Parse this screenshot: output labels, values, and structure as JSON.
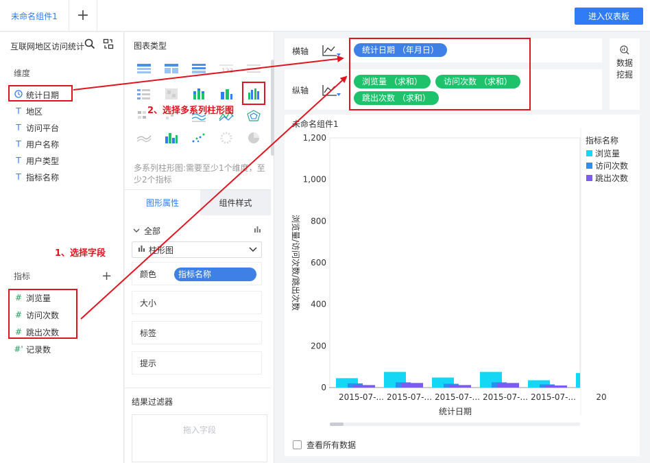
{
  "tabbar": {
    "active_tab": "未命名组件1",
    "add_symbol": "+",
    "dashboard_button": "进入仪表板"
  },
  "dataset": {
    "name": "互联网地区访问统计",
    "dimensions_title": "维度",
    "dimensions": [
      {
        "icon": "clock-icon",
        "label": "统计日期"
      },
      {
        "icon": "text-type-icon",
        "label": "地区"
      },
      {
        "icon": "text-type-icon",
        "label": "访问平台"
      },
      {
        "icon": "text-type-icon",
        "label": "用户名称"
      },
      {
        "icon": "text-type-icon",
        "label": "用户类型"
      },
      {
        "icon": "text-type-icon",
        "label": "指标名称"
      }
    ],
    "metrics_title": "指标",
    "metrics": [
      {
        "icon": "number-type-icon",
        "label": "浏览量"
      },
      {
        "icon": "number-type-icon",
        "label": "访问次数"
      },
      {
        "icon": "number-type-icon",
        "label": "跳出次数"
      },
      {
        "icon": "record-count-icon",
        "label": "记录数"
      }
    ]
  },
  "chart_types": {
    "title": "图表类型",
    "description": "多系列柱形图:需要至少1个维度，至少2个指标",
    "selected": "multi-series-bar"
  },
  "properties": {
    "tab_graphic": "图形属性",
    "tab_style": "组件样式",
    "all_label": "全部",
    "chart_type_value": "柱形图",
    "color_label": "颜色",
    "color_value": "指标名称",
    "size_label": "大小",
    "tag_label": "标签",
    "tooltip_label": "提示",
    "filter_title": "结果过滤器",
    "filter_placeholder": "拖入字段"
  },
  "axes": {
    "x_label": "横轴",
    "x_fields": [
      "统计日期 （年月日）"
    ],
    "y_label": "纵轴",
    "y_fields": [
      "浏览量 （求和）",
      "访问次数 （求和）",
      "跳出次数 （求和）"
    ]
  },
  "mining": {
    "line1": "数据",
    "line2": "挖掘"
  },
  "chart": {
    "title": "未命名组件1",
    "view_all": "查看所有数据"
  },
  "chart_data": {
    "type": "bar",
    "categories": [
      "2015-07-...",
      "2015-07-...",
      "2015-07-...",
      "2015-07-...",
      "2015-07-...",
      "20"
    ],
    "series": [
      {
        "name": "浏览量",
        "values": [
          45,
          75,
          48,
          75,
          35,
          70
        ]
      },
      {
        "name": "访问次数",
        "values": [
          20,
          25,
          18,
          25,
          15,
          20
        ]
      },
      {
        "name": "跳出次数",
        "values": [
          12,
          22,
          12,
          22,
          10,
          10
        ]
      }
    ],
    "ylim": [
      0,
      1200
    ],
    "yticks": [
      "0",
      "200",
      "400",
      "600",
      "800",
      "1,000",
      "1,200"
    ],
    "xlabel": "统计日期",
    "ylabel": "浏览量/访问次数/跳出次数",
    "legend_title": "指标名称",
    "legend_position": "right",
    "colors": [
      "#14d6f5",
      "#2b8ef0",
      "#7c5cf0"
    ]
  },
  "annotations": {
    "step1": "1、选择字段",
    "step2": "2、选择多系列柱形图"
  }
}
